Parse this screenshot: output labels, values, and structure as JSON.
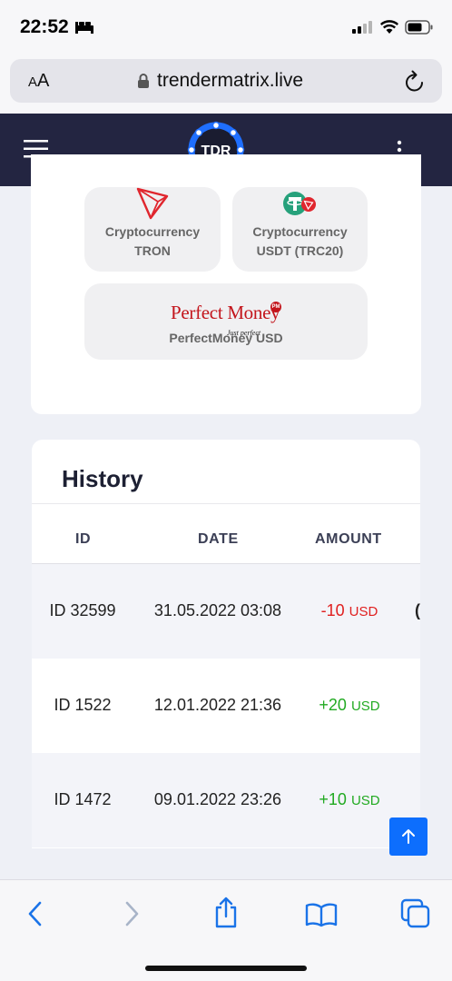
{
  "status": {
    "time": "22:52"
  },
  "browser": {
    "text_size_label": "A",
    "text_size_label_small": "A",
    "url": "trendermatrix.live"
  },
  "site": {
    "logo_text": "TDR"
  },
  "payment_options": [
    {
      "line1": "Cryptocurrency",
      "line2": "TRON",
      "icon": "tron-icon"
    },
    {
      "line1": "Cryptocurrency",
      "line2": "USDT (TRC20)",
      "icon": "tether-icon"
    },
    {
      "line1": "PerfectMoney USD",
      "logo_word": "Perfect Money",
      "logo_tag": "Just perfect",
      "logo_badge": "PM"
    }
  ],
  "history": {
    "title": "History",
    "columns": [
      "ID",
      "DATE",
      "AMOUNT"
    ],
    "rows": [
      {
        "id": "ID 32599",
        "date": "31.05.2022 03:08",
        "amount": "-10",
        "currency": "USD",
        "extra": "("
      },
      {
        "id": "ID 1522",
        "date": "12.01.2022 21:36",
        "amount": "+20",
        "currency": "USD"
      },
      {
        "id": "ID 1472",
        "date": "09.01.2022 23:26",
        "amount": "+10",
        "currency": "USD"
      }
    ]
  },
  "colors": {
    "header_bg": "#232541",
    "negative": "#e02020",
    "positive": "#22aa22",
    "accent": "#0d6efd"
  }
}
